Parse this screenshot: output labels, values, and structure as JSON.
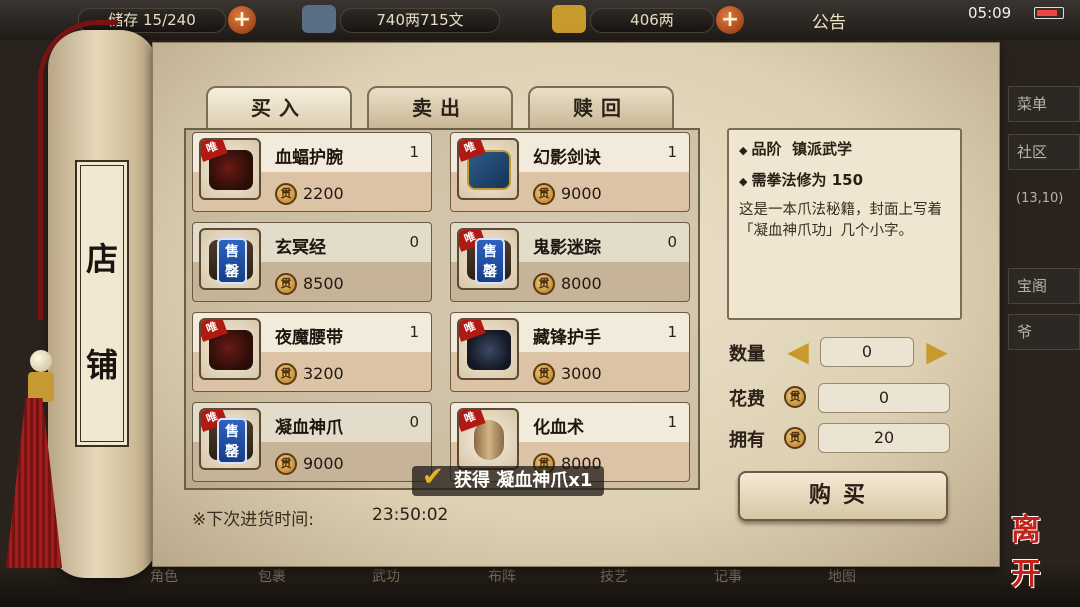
{
  "hud": {
    "backpack_label": "储存",
    "backpack_count": "15/240",
    "copper": "740两715文",
    "gold": "406两",
    "notice": "公告",
    "clock": "05:09",
    "plus": "+"
  },
  "side_menu": [
    "菜单",
    "社区",
    "(13,10)",
    "宝阁",
    "爷"
  ],
  "scroll_title": [
    "店",
    "铺"
  ],
  "tabs": [
    {
      "label": "买入",
      "active": true
    },
    {
      "label": "卖出",
      "active": false
    },
    {
      "label": "赎回",
      "active": false
    }
  ],
  "coin_glyph": "贯",
  "unique_glyph": "唯",
  "soldout_glyph": [
    "售",
    "罄"
  ],
  "items": [
    {
      "name": "血蝠护腕",
      "count": "1",
      "price": "2200",
      "unique": true,
      "soldout": false,
      "icon": "wrist-guard-icon",
      "art": "red"
    },
    {
      "name": "幻影剑诀",
      "count": "1",
      "price": "9000",
      "unique": true,
      "soldout": false,
      "icon": "sword-manual-icon",
      "art": "blue"
    },
    {
      "name": "玄冥经",
      "count": "0",
      "price": "8500",
      "unique": false,
      "soldout": true,
      "icon": "scripture-icon",
      "art": "manual"
    },
    {
      "name": "鬼影迷踪",
      "count": "0",
      "price": "8000",
      "unique": true,
      "soldout": true,
      "icon": "footwork-manual-icon",
      "art": "manual"
    },
    {
      "name": "夜魔腰带",
      "count": "1",
      "price": "3200",
      "unique": true,
      "soldout": false,
      "icon": "belt-icon",
      "art": "red"
    },
    {
      "name": "藏锋护手",
      "count": "1",
      "price": "3000",
      "unique": true,
      "soldout": false,
      "icon": "gauntlet-icon",
      "art": "dark"
    },
    {
      "name": "凝血神爪",
      "count": "0",
      "price": "9000",
      "unique": true,
      "soldout": true,
      "icon": "claw-manual-icon",
      "art": "manual"
    },
    {
      "name": "化血术",
      "count": "1",
      "price": "8000",
      "unique": true,
      "soldout": false,
      "icon": "scroll-icon",
      "art": "scrollart"
    }
  ],
  "detail": {
    "grade_label": "品阶",
    "grade_value": "镇派武学",
    "requirement": "需拳法修为 150",
    "description": "这是一本爪法秘籍，封面上写着「凝血神爪功」几个小字。"
  },
  "controls": {
    "quantity_label": "数量",
    "quantity_value": "0",
    "cost_label": "花费",
    "cost_value": "0",
    "owned_label": "拥有",
    "owned_value": "20",
    "buy_label": "购买"
  },
  "restock": {
    "label": "※下次进货时间:",
    "time": "23:50:02"
  },
  "toast": "获得 凝血神爪x1",
  "leave_label": "离开",
  "bottom_menu": [
    "角色",
    "包裹",
    "武功",
    "布阵",
    "技艺",
    "记事",
    "地图"
  ]
}
